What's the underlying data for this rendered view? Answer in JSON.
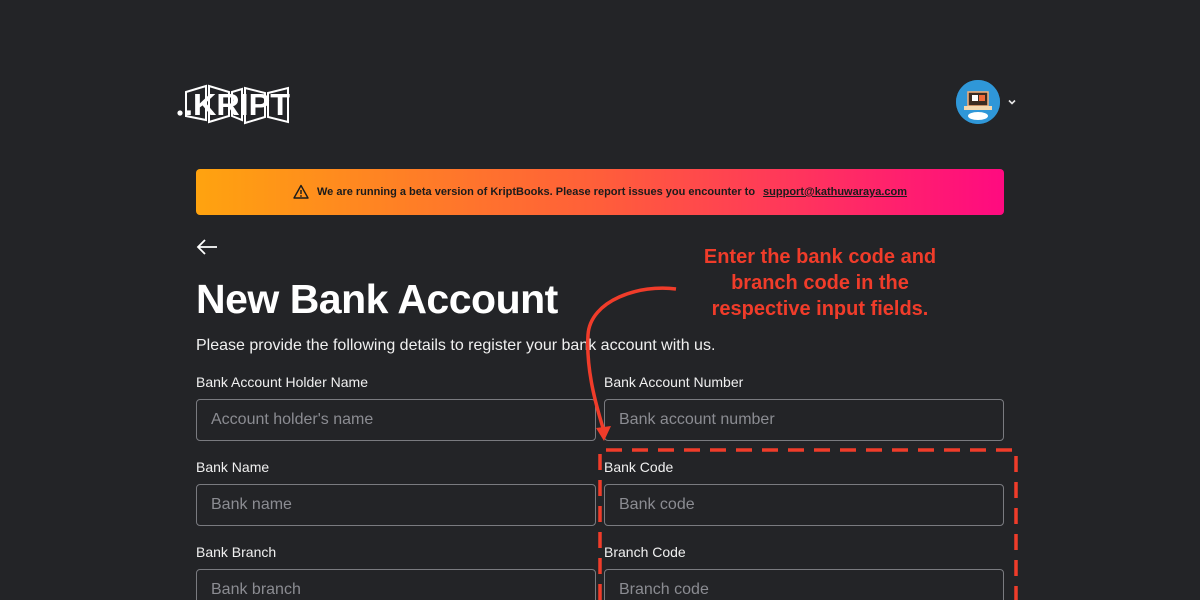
{
  "header": {
    "logo_text": ".KRIPT",
    "avatar_icon": "user-avatar-icon",
    "menu_icon": "chevron-down-icon"
  },
  "banner": {
    "icon": "warning-icon",
    "message": "We are running a beta version of KriptBooks. Please report issues you encounter to",
    "email": "support@kathuwaraya.com",
    "gradient": [
      "#ffa30f",
      "#ff5e3a",
      "#ff0a80"
    ]
  },
  "page": {
    "back_icon": "arrow-left-icon",
    "title": "New Bank Account",
    "subtitle": "Please provide the following details to register your bank account with us."
  },
  "form": {
    "holder_name": {
      "label": "Bank Account Holder Name",
      "placeholder": "Account holder's name"
    },
    "account_number": {
      "label": "Bank Account Number",
      "placeholder": "Bank account number"
    },
    "bank_name": {
      "label": "Bank Name",
      "placeholder": "Bank name"
    },
    "bank_code": {
      "label": "Bank Code",
      "placeholder": "Bank code"
    },
    "bank_branch": {
      "label": "Bank Branch",
      "placeholder": "Bank branch"
    },
    "branch_code": {
      "label": "Branch Code",
      "placeholder": "Branch code"
    }
  },
  "annotation": {
    "text": "Enter the bank code and branch code in the respective input fields.",
    "color": "#f03c2a"
  }
}
